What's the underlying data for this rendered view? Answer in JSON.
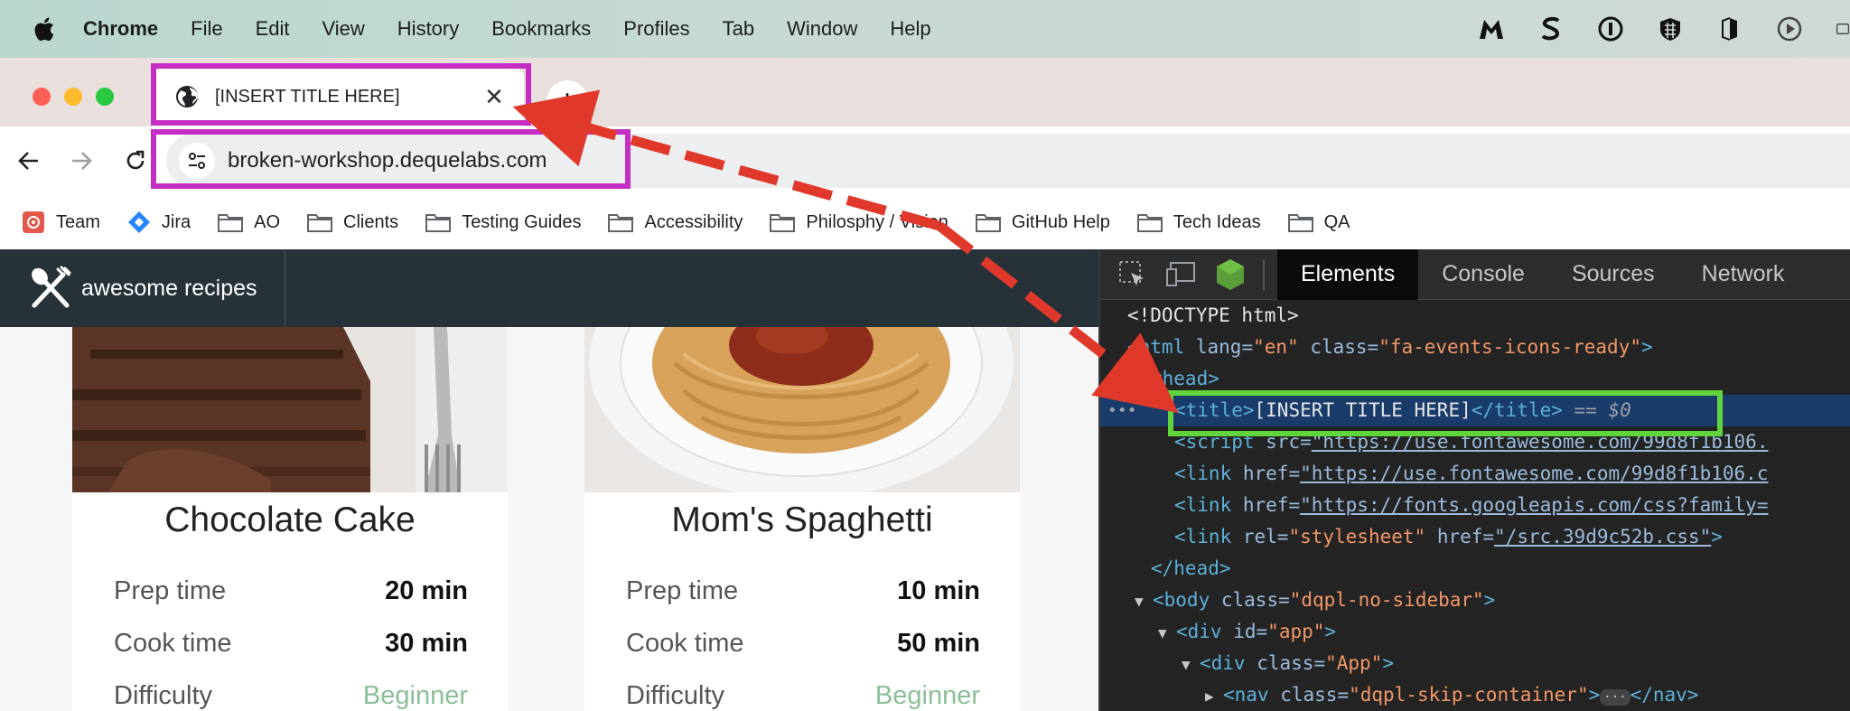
{
  "menubar": {
    "app": "Chrome",
    "items": [
      "File",
      "Edit",
      "View",
      "History",
      "Bookmarks",
      "Profiles",
      "Tab",
      "Window",
      "Help"
    ],
    "tray_icons": [
      "m-icon",
      "s-icon",
      "1password-icon",
      "grid-shield-icon",
      "halfmoon-icon",
      "play-circle-icon",
      "partial-icon"
    ]
  },
  "tab": {
    "title": "[INSERT TITLE HERE]",
    "close_glyph": "✕",
    "new_tab_glyph": "+"
  },
  "toolbar": {
    "url": "broken-workshop.dequelabs.com"
  },
  "bookmarks": [
    {
      "label": "Team",
      "icon": "team-icon"
    },
    {
      "label": "Jira",
      "icon": "jira-icon"
    },
    {
      "label": "AO",
      "icon": "folder-icon"
    },
    {
      "label": "Clients",
      "icon": "folder-icon"
    },
    {
      "label": "Testing Guides",
      "icon": "folder-icon"
    },
    {
      "label": "Accessibility",
      "icon": "folder-icon"
    },
    {
      "label": "Philosphy / Vision",
      "icon": "folder-icon"
    },
    {
      "label": "GitHub Help",
      "icon": "folder-icon"
    },
    {
      "label": "Tech Ideas",
      "icon": "folder-icon"
    },
    {
      "label": "QA",
      "icon": "folder-icon"
    }
  ],
  "app": {
    "brand": "awesome recipes",
    "cards": [
      {
        "title": "Chocolate Cake",
        "rows": [
          {
            "label": "Prep time",
            "value": "20 min"
          },
          {
            "label": "Cook time",
            "value": "30 min"
          },
          {
            "label": "Difficulty",
            "value": "Beginner"
          }
        ]
      },
      {
        "title": "Mom's Spaghetti",
        "rows": [
          {
            "label": "Prep time",
            "value": "10 min"
          },
          {
            "label": "Cook time",
            "value": "50 min"
          },
          {
            "label": "Difficulty",
            "value": "Beginner"
          }
        ]
      }
    ]
  },
  "devtools": {
    "tabs": [
      "Elements",
      "Console",
      "Sources",
      "Network"
    ],
    "active_tab": "Elements",
    "lines": {
      "doctype": "<!DOCTYPE html>",
      "html_open_tag": "<html",
      "html_attr1_name": "lang=",
      "html_attr1_value": "\"en\"",
      "html_attr2_name": "class=",
      "html_attr2_value": "\"fa-events-icons-ready\"",
      "html_close_bracket": ">",
      "head_open": "<head>",
      "title_open": "<title>",
      "title_text": "[INSERT TITLE HERE]",
      "title_close": "</title>",
      "selected_marker": "== $0",
      "script_tag": "<script",
      "script_attr": "src=",
      "script_src": "\"https://use.fontawesome.com/99d8f1b106.",
      "link1_tag": "<link",
      "link1_attr": "href=",
      "link1_href": "\"https://use.fontawesome.com/99d8f1b106.c",
      "link2_tag": "<link",
      "link2_attr": "href=",
      "link2_href": "\"https://fonts.googleapis.com/css?family=",
      "link3_tag": "<link",
      "link3_rel_name": "rel=",
      "link3_rel_value": "\"stylesheet\"",
      "link3_href_name": "href=",
      "link3_href_value": "\"/src.39d9c52b.css\"",
      "link3_close": ">",
      "head_close": "</head>",
      "body_tag": "<body",
      "body_attr": "class=",
      "body_class": "\"dqpl-no-sidebar\"",
      "body_close": ">",
      "div_app_tag": "<div",
      "div_app_attr": "id=",
      "div_app_value": "\"app\"",
      "div_app_close": ">",
      "div_App_tag": "<div",
      "div_App_attr": "class=",
      "div_App_value": "\"App\"",
      "div_App_close": ">",
      "nav_tag": "<nav",
      "nav_attr": "class=",
      "nav_value": "\"dqpl-skip-container\"",
      "nav_close_open": ">",
      "nav_ellipsis": "···",
      "nav_close": "</nav>"
    }
  },
  "colors": {
    "highlight_magenta": "#c52ec2",
    "highlight_green": "#61d43c",
    "arrow_red": "#e0392b"
  }
}
